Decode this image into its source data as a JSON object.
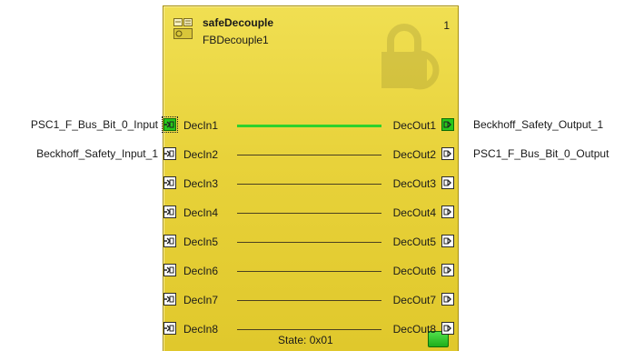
{
  "block": {
    "title": "safeDecouple",
    "instance": "FBDecouple1",
    "index": "1",
    "state": "State: 0x01",
    "color": "#e8d23a",
    "icon": "function-block-icon",
    "watermark_icon": "lock-gear-icon"
  },
  "inputs": [
    {
      "pin": "DecIn1",
      "variable": "PSC1_F_Bus_Bit_0_Input",
      "active": true
    },
    {
      "pin": "DecIn2",
      "variable": "Beckhoff_Safety_Input_1",
      "active": false
    },
    {
      "pin": "DecIn3",
      "variable": "",
      "active": false
    },
    {
      "pin": "DecIn4",
      "variable": "",
      "active": false
    },
    {
      "pin": "DecIn5",
      "variable": "",
      "active": false
    },
    {
      "pin": "DecIn6",
      "variable": "",
      "active": false
    },
    {
      "pin": "DecIn7",
      "variable": "",
      "active": false
    },
    {
      "pin": "DecIn8",
      "variable": "",
      "active": false
    }
  ],
  "outputs": [
    {
      "pin": "DecOut1",
      "variable": "Beckhoff_Safety_Output_1",
      "active": true
    },
    {
      "pin": "DecOut2",
      "variable": "PSC1_F_Bus_Bit_0_Output",
      "active": false
    },
    {
      "pin": "DecOut3",
      "variable": "",
      "active": false
    },
    {
      "pin": "DecOut4",
      "variable": "",
      "active": false
    },
    {
      "pin": "DecOut5",
      "variable": "",
      "active": false
    },
    {
      "pin": "DecOut6",
      "variable": "",
      "active": false
    },
    {
      "pin": "DecOut7",
      "variable": "",
      "active": false
    },
    {
      "pin": "DecOut8",
      "variable": "",
      "active": false
    }
  ],
  "colors": {
    "active_signal": "#2fd12b",
    "inactive_line": "#4a4020"
  }
}
